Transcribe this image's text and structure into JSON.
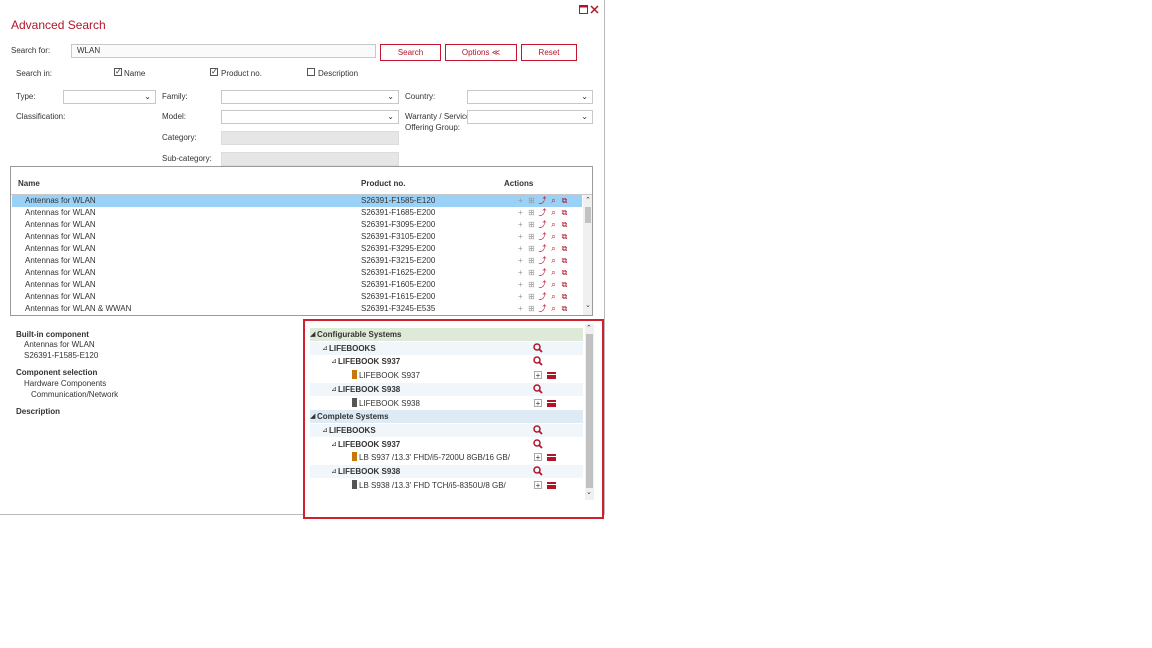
{
  "dialog": {
    "title": "Advanced Search",
    "maximize_icon": "window-maximize-icon",
    "close_icon": "close-icon"
  },
  "search": {
    "label": "Search for:",
    "value": "WLAN",
    "search_button": "Search",
    "options_button": "Options ≪",
    "reset_button": "Reset"
  },
  "search_in": {
    "label": "Search in:",
    "options": [
      {
        "label": "Name",
        "checked": true
      },
      {
        "label": "Product no.",
        "checked": true
      },
      {
        "label": "Description",
        "checked": false
      }
    ]
  },
  "filters": {
    "type_label": "Type:",
    "family_label": "Family:",
    "country_label": "Country:",
    "classification_label": "Classification:",
    "model_label": "Model:",
    "warranty_label_1": "Warranty / Service",
    "warranty_label_2": "Offering Group:",
    "category_label": "Category:",
    "subcategory_label": "Sub-category:"
  },
  "results": {
    "columns": {
      "name": "Name",
      "product": "Product no.",
      "actions": "Actions"
    },
    "rows": [
      {
        "name": "Antennas for WLAN",
        "product": "S26391-F1585-E120",
        "selected": true
      },
      {
        "name": "Antennas for WLAN",
        "product": "S26391-F1685-E200"
      },
      {
        "name": "Antennas for WLAN",
        "product": "S26391-F3095-E200"
      },
      {
        "name": "Antennas for WLAN",
        "product": "S26391-F3105-E200"
      },
      {
        "name": "Antennas for WLAN",
        "product": "S26391-F3295-E200"
      },
      {
        "name": "Antennas for WLAN",
        "product": "S26391-F3215-E200"
      },
      {
        "name": "Antennas for WLAN",
        "product": "S26391-F1625-E200"
      },
      {
        "name": "Antennas for WLAN",
        "product": "S26391-F1605-E200"
      },
      {
        "name": "Antennas for WLAN",
        "product": "S26391-F1615-E200"
      },
      {
        "name": "Antennas for WLAN & WWAN",
        "product": "S26391-F3245-E535"
      }
    ],
    "action_icons": [
      "add-icon",
      "add-to-list-icon",
      "export-icon",
      "search-icon",
      "compare-icon"
    ]
  },
  "details": {
    "builtin_heading": "Built-in component",
    "builtin_name": "Antennas for WLAN",
    "builtin_product": "S26391-F1585-E120",
    "component_heading": "Component selection",
    "component_path_1": "Hardware Components",
    "component_path_2": "Communication/Network",
    "description_heading": "Description"
  },
  "tree": {
    "nodes": [
      {
        "label": "Configurable Systems",
        "level": 0,
        "style": "green",
        "bold": true,
        "expander": "◢"
      },
      {
        "label": "LIFEBOOKS",
        "level": 1,
        "style": "light",
        "bold": true,
        "expander": "⊿",
        "search": true
      },
      {
        "label": "LIFEBOOK S937",
        "level": 2,
        "style": "none",
        "bold": true,
        "expander": "⊿",
        "search": true
      },
      {
        "label": "LIFEBOOK S937",
        "level": 3,
        "style": "none",
        "bold": false,
        "book": "#c8780a",
        "add": true,
        "menu": true
      },
      {
        "label": "LIFEBOOK S938",
        "level": 2,
        "style": "light",
        "bold": true,
        "expander": "⊿",
        "search": true
      },
      {
        "label": "LIFEBOOK S938",
        "level": 3,
        "style": "none",
        "bold": false,
        "book": "#555555",
        "add": true,
        "menu": true
      },
      {
        "label": "Complete Systems",
        "level": 0,
        "style": "blue",
        "bold": true,
        "expander": "◢"
      },
      {
        "label": "LIFEBOOKS",
        "level": 1,
        "style": "light",
        "bold": true,
        "expander": "⊿",
        "search": true
      },
      {
        "label": "LIFEBOOK S937",
        "level": 2,
        "style": "none",
        "bold": true,
        "expander": "⊿",
        "search": true
      },
      {
        "label": "LB S937 /13.3' FHD/i5-7200U 8GB/16 GB/",
        "level": 3,
        "style": "none",
        "bold": false,
        "book": "#c8780a",
        "add": true,
        "menu": true
      },
      {
        "label": "LIFEBOOK S938",
        "level": 2,
        "style": "light",
        "bold": true,
        "expander": "⊿",
        "search": true
      },
      {
        "label": "LB S938 /13.3' FHD TCH/i5-8350U/8 GB/",
        "level": 3,
        "style": "none",
        "bold": false,
        "book": "#555555",
        "add": true,
        "menu": true
      }
    ]
  },
  "colors": {
    "accent": "#b0152a",
    "selection": "#99d1f7",
    "highlight_border": "#d0202e"
  }
}
